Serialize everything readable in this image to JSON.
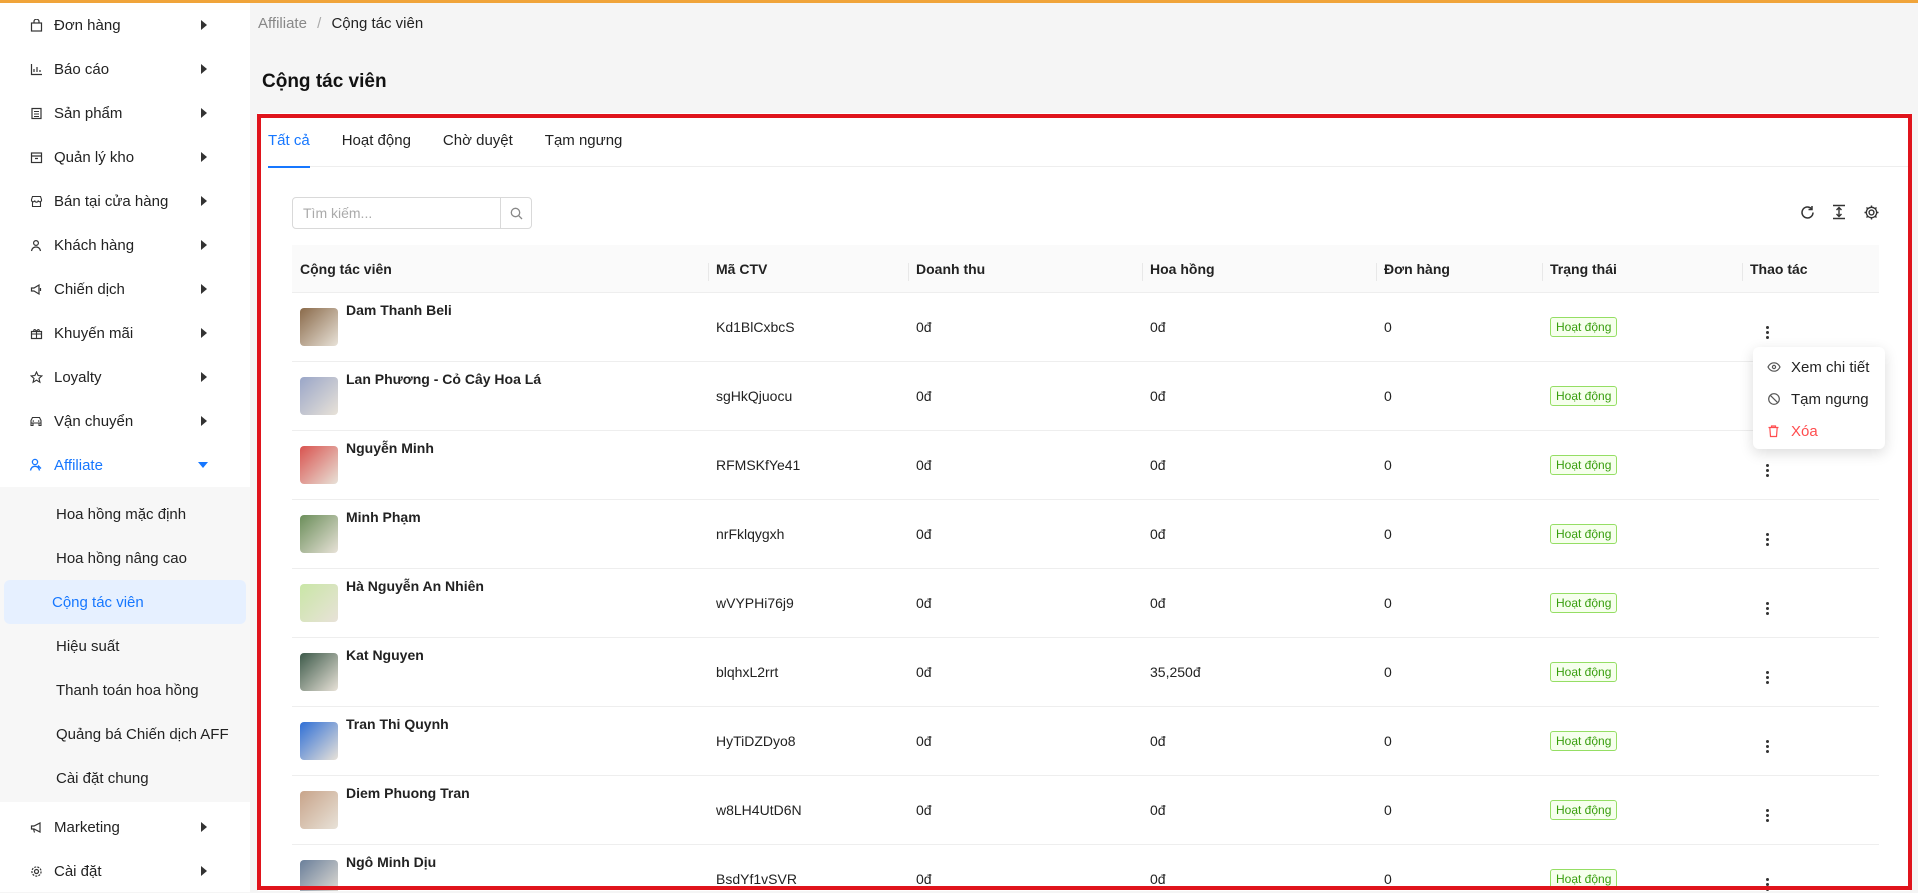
{
  "sidebar": {
    "items": [
      {
        "label": "Đơn hàng",
        "icon": "shopping-bag-icon"
      },
      {
        "label": "Báo cáo",
        "icon": "bar-chart-icon"
      },
      {
        "label": "Sản phẩm",
        "icon": "product-icon"
      },
      {
        "label": "Quản lý kho",
        "icon": "warehouse-icon"
      },
      {
        "label": "Bán tại cửa hàng",
        "icon": "store-icon"
      },
      {
        "label": "Khách hàng",
        "icon": "customer-icon"
      },
      {
        "label": "Chiến dịch",
        "icon": "megaphone-icon"
      },
      {
        "label": "Khuyến mãi",
        "icon": "gift-icon"
      },
      {
        "label": "Loyalty",
        "icon": "star-icon"
      },
      {
        "label": "Vận chuyển",
        "icon": "car-icon"
      }
    ],
    "affiliate": {
      "label": "Affiliate",
      "icon": "affiliate-icon",
      "subitems": [
        "Hoa hồng mặc định",
        "Hoa hồng nâng cao",
        "Cộng tác viên",
        "Hiệu suất",
        "Thanh toán hoa hồng",
        "Quảng bá Chiến dịch AFF",
        "Cài đặt chung"
      ]
    },
    "bottom": [
      {
        "label": "Marketing",
        "icon": "marketing-icon"
      },
      {
        "label": "Cài đặt",
        "icon": "settings-icon"
      }
    ]
  },
  "breadcrumb": {
    "root": "Affiliate",
    "separator": "/",
    "current": "Cộng tác viên"
  },
  "page": {
    "title": "Cộng tác viên"
  },
  "tabs": [
    "Tất cả",
    "Hoạt động",
    "Chờ duyệt",
    "Tạm ngưng"
  ],
  "search": {
    "placeholder": "Tìm kiếm..."
  },
  "table": {
    "headers": [
      "Cộng tác viên",
      "Mã CTV",
      "Doanh thu",
      "Hoa hồng",
      "Đơn hàng",
      "Trạng thái",
      "Thao tác"
    ],
    "rows": [
      {
        "name": "Dam Thanh Beli",
        "code": "Kd1BlCxbcS",
        "revenue": "0đ",
        "commission": "0đ",
        "orders": "0",
        "status": "Hoạt động",
        "avatar_color": "#8a6a4a"
      },
      {
        "name": "Lan Phương - Cỏ Cây Hoa Lá",
        "code": "sgHkQjuocu",
        "revenue": "0đ",
        "commission": "0đ",
        "orders": "0",
        "status": "Hoạt động",
        "avatar_color": "#9aa6c8"
      },
      {
        "name": "Nguyễn Minh",
        "code": "RFMSKfYe41",
        "revenue": "0đ",
        "commission": "0đ",
        "orders": "0",
        "status": "Hoạt động",
        "avatar_color": "#d9534f"
      },
      {
        "name": "Minh Phạm",
        "code": "nrFklqygxh",
        "revenue": "0đ",
        "commission": "0đ",
        "orders": "0",
        "status": "Hoạt động",
        "avatar_color": "#6b8e5a"
      },
      {
        "name": "Hà Nguyễn An Nhiên",
        "code": "wVYPHi76j9",
        "revenue": "0đ",
        "commission": "0đ",
        "orders": "0",
        "status": "Hoạt động",
        "avatar_color": "#c9e6a6"
      },
      {
        "name": "Kat Nguyen",
        "code": "blqhxL2rrt",
        "revenue": "0đ",
        "commission": "35,250đ",
        "orders": "0",
        "status": "Hoạt động",
        "avatar_color": "#3d5a4a"
      },
      {
        "name": "Tran Thi Quynh",
        "code": "HyTiDZDyo8",
        "revenue": "0đ",
        "commission": "0đ",
        "orders": "0",
        "status": "Hoạt động",
        "avatar_color": "#2f6fd6"
      },
      {
        "name": "Diem Phuong Tran",
        "code": "w8LH4UtD6N",
        "revenue": "0đ",
        "commission": "0đ",
        "orders": "0",
        "status": "Hoạt động",
        "avatar_color": "#c8a48a"
      },
      {
        "name": "Ngô Minh Dịu",
        "code": "BsdYf1vSVR",
        "revenue": "0đ",
        "commission": "0đ",
        "orders": "0",
        "status": "Hoạt động",
        "avatar_color": "#6a7f9a"
      }
    ]
  },
  "action_menu": {
    "items": [
      {
        "label": "Xem chi tiết",
        "icon": "eye-icon"
      },
      {
        "label": "Tạm ngưng",
        "icon": "ban-icon"
      },
      {
        "label": "Xóa",
        "icon": "trash-icon"
      }
    ]
  },
  "colors": {
    "accent": "#1677ff",
    "status_green": "#389e0d",
    "danger": "#ff4d4f",
    "frame_red": "#e0141c",
    "top_bar": "#f0a43a"
  }
}
